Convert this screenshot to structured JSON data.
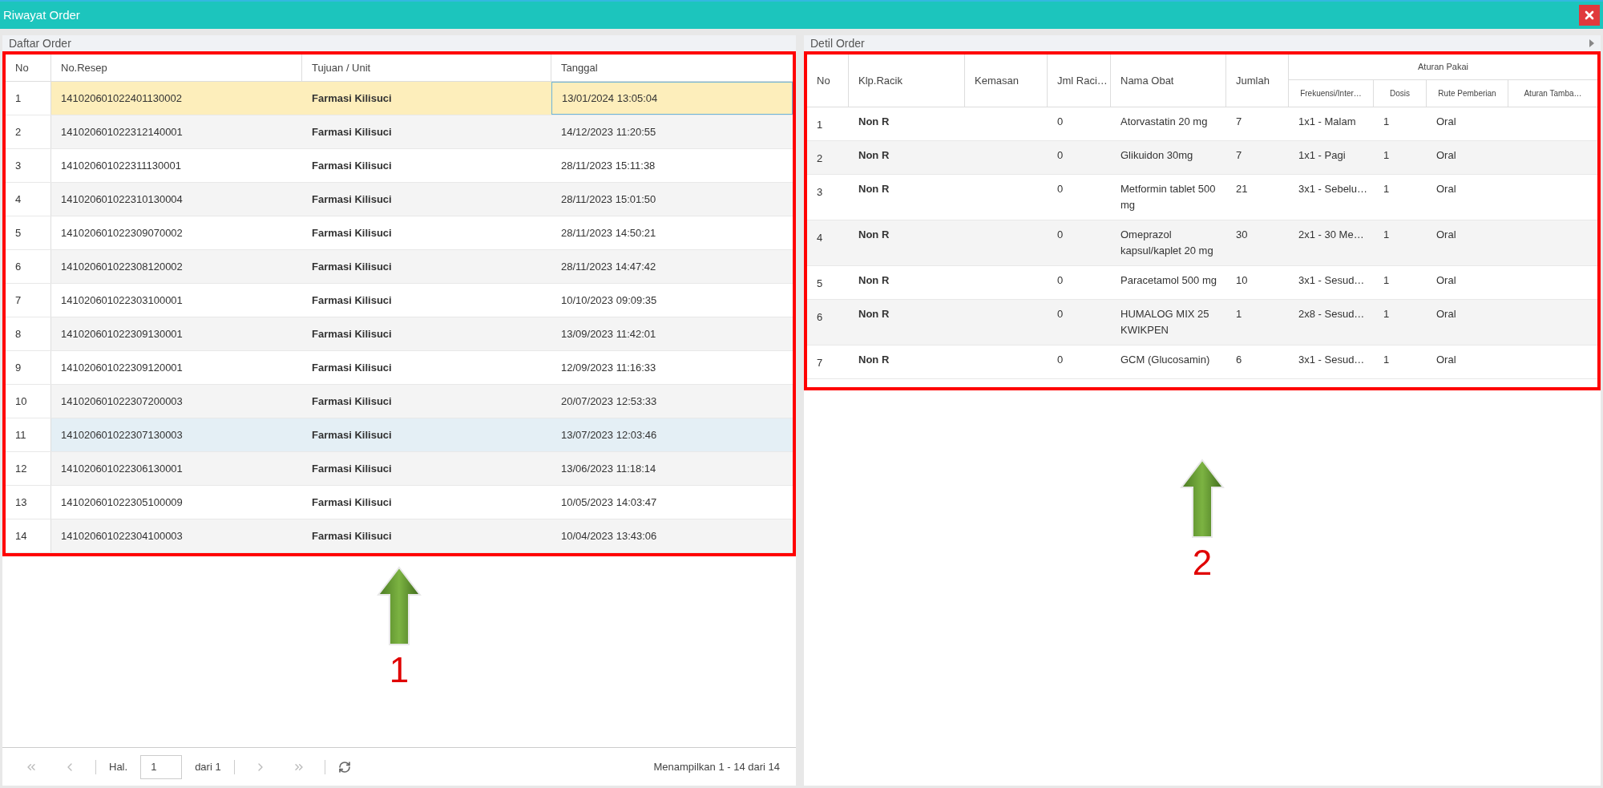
{
  "window": {
    "title": "Riwayat Order"
  },
  "left_panel": {
    "title": "Daftar Order",
    "callout": {
      "number": "1"
    },
    "columns": [
      "No",
      "No.Resep",
      "Tujuan / Unit",
      "Tanggal"
    ],
    "rows": [
      {
        "cells": [
          "1",
          "141020601022401130002",
          "Farmasi Kilisuci",
          "13/01/2024 13:05:04"
        ],
        "selected": true,
        "hovered": false
      },
      {
        "cells": [
          "2",
          "141020601022312140001",
          "Farmasi Kilisuci",
          "14/12/2023 11:20:55"
        ],
        "selected": false,
        "hovered": false
      },
      {
        "cells": [
          "3",
          "141020601022311130001",
          "Farmasi Kilisuci",
          "28/11/2023 15:11:38"
        ],
        "selected": false,
        "hovered": false
      },
      {
        "cells": [
          "4",
          "141020601022310130004",
          "Farmasi Kilisuci",
          "28/11/2023 15:01:50"
        ],
        "selected": false,
        "hovered": false
      },
      {
        "cells": [
          "5",
          "141020601022309070002",
          "Farmasi Kilisuci",
          "28/11/2023 14:50:21"
        ],
        "selected": false,
        "hovered": false
      },
      {
        "cells": [
          "6",
          "141020601022308120002",
          "Farmasi Kilisuci",
          "28/11/2023 14:47:42"
        ],
        "selected": false,
        "hovered": false
      },
      {
        "cells": [
          "7",
          "141020601022303100001",
          "Farmasi Kilisuci",
          "10/10/2023 09:09:35"
        ],
        "selected": false,
        "hovered": false
      },
      {
        "cells": [
          "8",
          "141020601022309130001",
          "Farmasi Kilisuci",
          "13/09/2023 11:42:01"
        ],
        "selected": false,
        "hovered": false
      },
      {
        "cells": [
          "9",
          "141020601022309120001",
          "Farmasi Kilisuci",
          "12/09/2023 11:16:33"
        ],
        "selected": false,
        "hovered": false
      },
      {
        "cells": [
          "10",
          "141020601022307200003",
          "Farmasi Kilisuci",
          "20/07/2023 12:53:33"
        ],
        "selected": false,
        "hovered": false
      },
      {
        "cells": [
          "11",
          "141020601022307130003",
          "Farmasi Kilisuci",
          "13/07/2023 12:03:46"
        ],
        "selected": false,
        "hovered": true
      },
      {
        "cells": [
          "12",
          "141020601022306130001",
          "Farmasi Kilisuci",
          "13/06/2023 11:18:14"
        ],
        "selected": false,
        "hovered": false
      },
      {
        "cells": [
          "13",
          "141020601022305100009",
          "Farmasi Kilisuci",
          "10/05/2023 14:03:47"
        ],
        "selected": false,
        "hovered": false
      },
      {
        "cells": [
          "14",
          "141020601022304100003",
          "Farmasi Kilisuci",
          "10/04/2023 13:43:06"
        ],
        "selected": false,
        "hovered": false
      }
    ],
    "pager": {
      "buttons": [
        {
          "kind": "first",
          "disabled": true
        },
        {
          "kind": "prev",
          "disabled": true
        },
        {
          "kind": "next",
          "disabled": true
        },
        {
          "kind": "last",
          "disabled": true
        }
      ],
      "page_label": "Hal.",
      "page_value": "1",
      "page_total": "dari 1",
      "summary": "Menampilkan 1 - 14 dari 14"
    }
  },
  "right_panel": {
    "title": "Detil Order",
    "callout": {
      "number": "2"
    },
    "columns": [
      "No",
      "Klp.Racik",
      "Kemasan",
      "Jml Raci…",
      "Nama Obat",
      "Jumlah"
    ],
    "group": {
      "title": "Aturan Pakai",
      "columns": [
        "Frekuensi/Inter…",
        "Dosis",
        "Rute Pemberian",
        "Aturan Tamba…"
      ]
    },
    "rows": [
      {
        "cells": [
          "1",
          "Non R",
          "",
          "0",
          "Atorvastatin 20 mg",
          "7",
          "1x1 - Malam",
          "1",
          "Oral",
          ""
        ]
      },
      {
        "cells": [
          "2",
          "Non R",
          "",
          "0",
          "Glikuidon 30mg",
          "7",
          "1x1 - Pagi",
          "1",
          "Oral",
          ""
        ]
      },
      {
        "cells": [
          "3",
          "Non R",
          "",
          "0",
          "Metformin tablet 500 mg",
          "21",
          "3x1 - Sebelu…",
          "1",
          "Oral",
          ""
        ]
      },
      {
        "cells": [
          "4",
          "Non R",
          "",
          "0",
          "Omeprazol kapsul/kaplet 20 mg",
          "30",
          "2x1 - 30 Me…",
          "1",
          "Oral",
          ""
        ]
      },
      {
        "cells": [
          "5",
          "Non R",
          "",
          "0",
          "Paracetamol 500 mg",
          "10",
          "3x1 - Sesud…",
          "1",
          "Oral",
          ""
        ]
      },
      {
        "cells": [
          "6",
          "Non R",
          "",
          "0",
          "HUMALOG MIX 25 KWIKPEN",
          "1",
          "2x8 - Sesud…",
          "1",
          "Oral",
          ""
        ]
      },
      {
        "cells": [
          "7",
          "Non R",
          "",
          "0",
          "GCM (Glucosamin)",
          "6",
          "3x1 - Sesud…",
          "1",
          "Oral",
          ""
        ]
      }
    ]
  }
}
